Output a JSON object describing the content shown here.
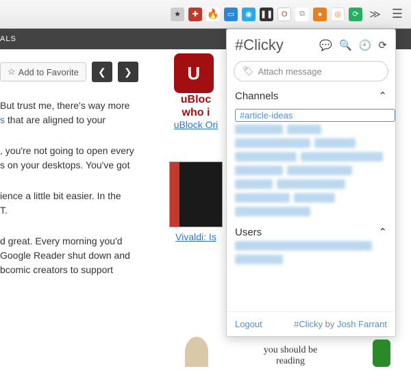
{
  "toolbar": {
    "strip_label": "ALS"
  },
  "fav": {
    "label": "Add to Favorite"
  },
  "paragraphs": {
    "p1a": "But trust me, there's way more",
    "p1b_link": "s",
    "p1b_rest": " that are aligned to your",
    "p2a": ", you're not going to open every",
    "p2b": "s on your desktops. You've got",
    "p3a": "ience a little bit easier. In the",
    "p3b": "T.",
    "p4a": "d great. Every morning you'd",
    "p4b": "Google Reader shut down and",
    "p4c": "bcomic creators to support"
  },
  "mid": {
    "ublock_title": "uBloc",
    "ublock_sub": "who i",
    "ublock_link": "uBlock Ori",
    "vivaldi_link": "Vivaldi: Is"
  },
  "popup": {
    "title": "#Clicky",
    "attach_placeholder": "Attach message",
    "channels_label": "Channels",
    "channel_chip": "#article-ideas",
    "users_label": "Users",
    "logout": "Logout",
    "brand": "#Clicky",
    "by": " by ",
    "author": "Josh Farrant"
  },
  "comic": {
    "text": "you should be\nreading"
  }
}
